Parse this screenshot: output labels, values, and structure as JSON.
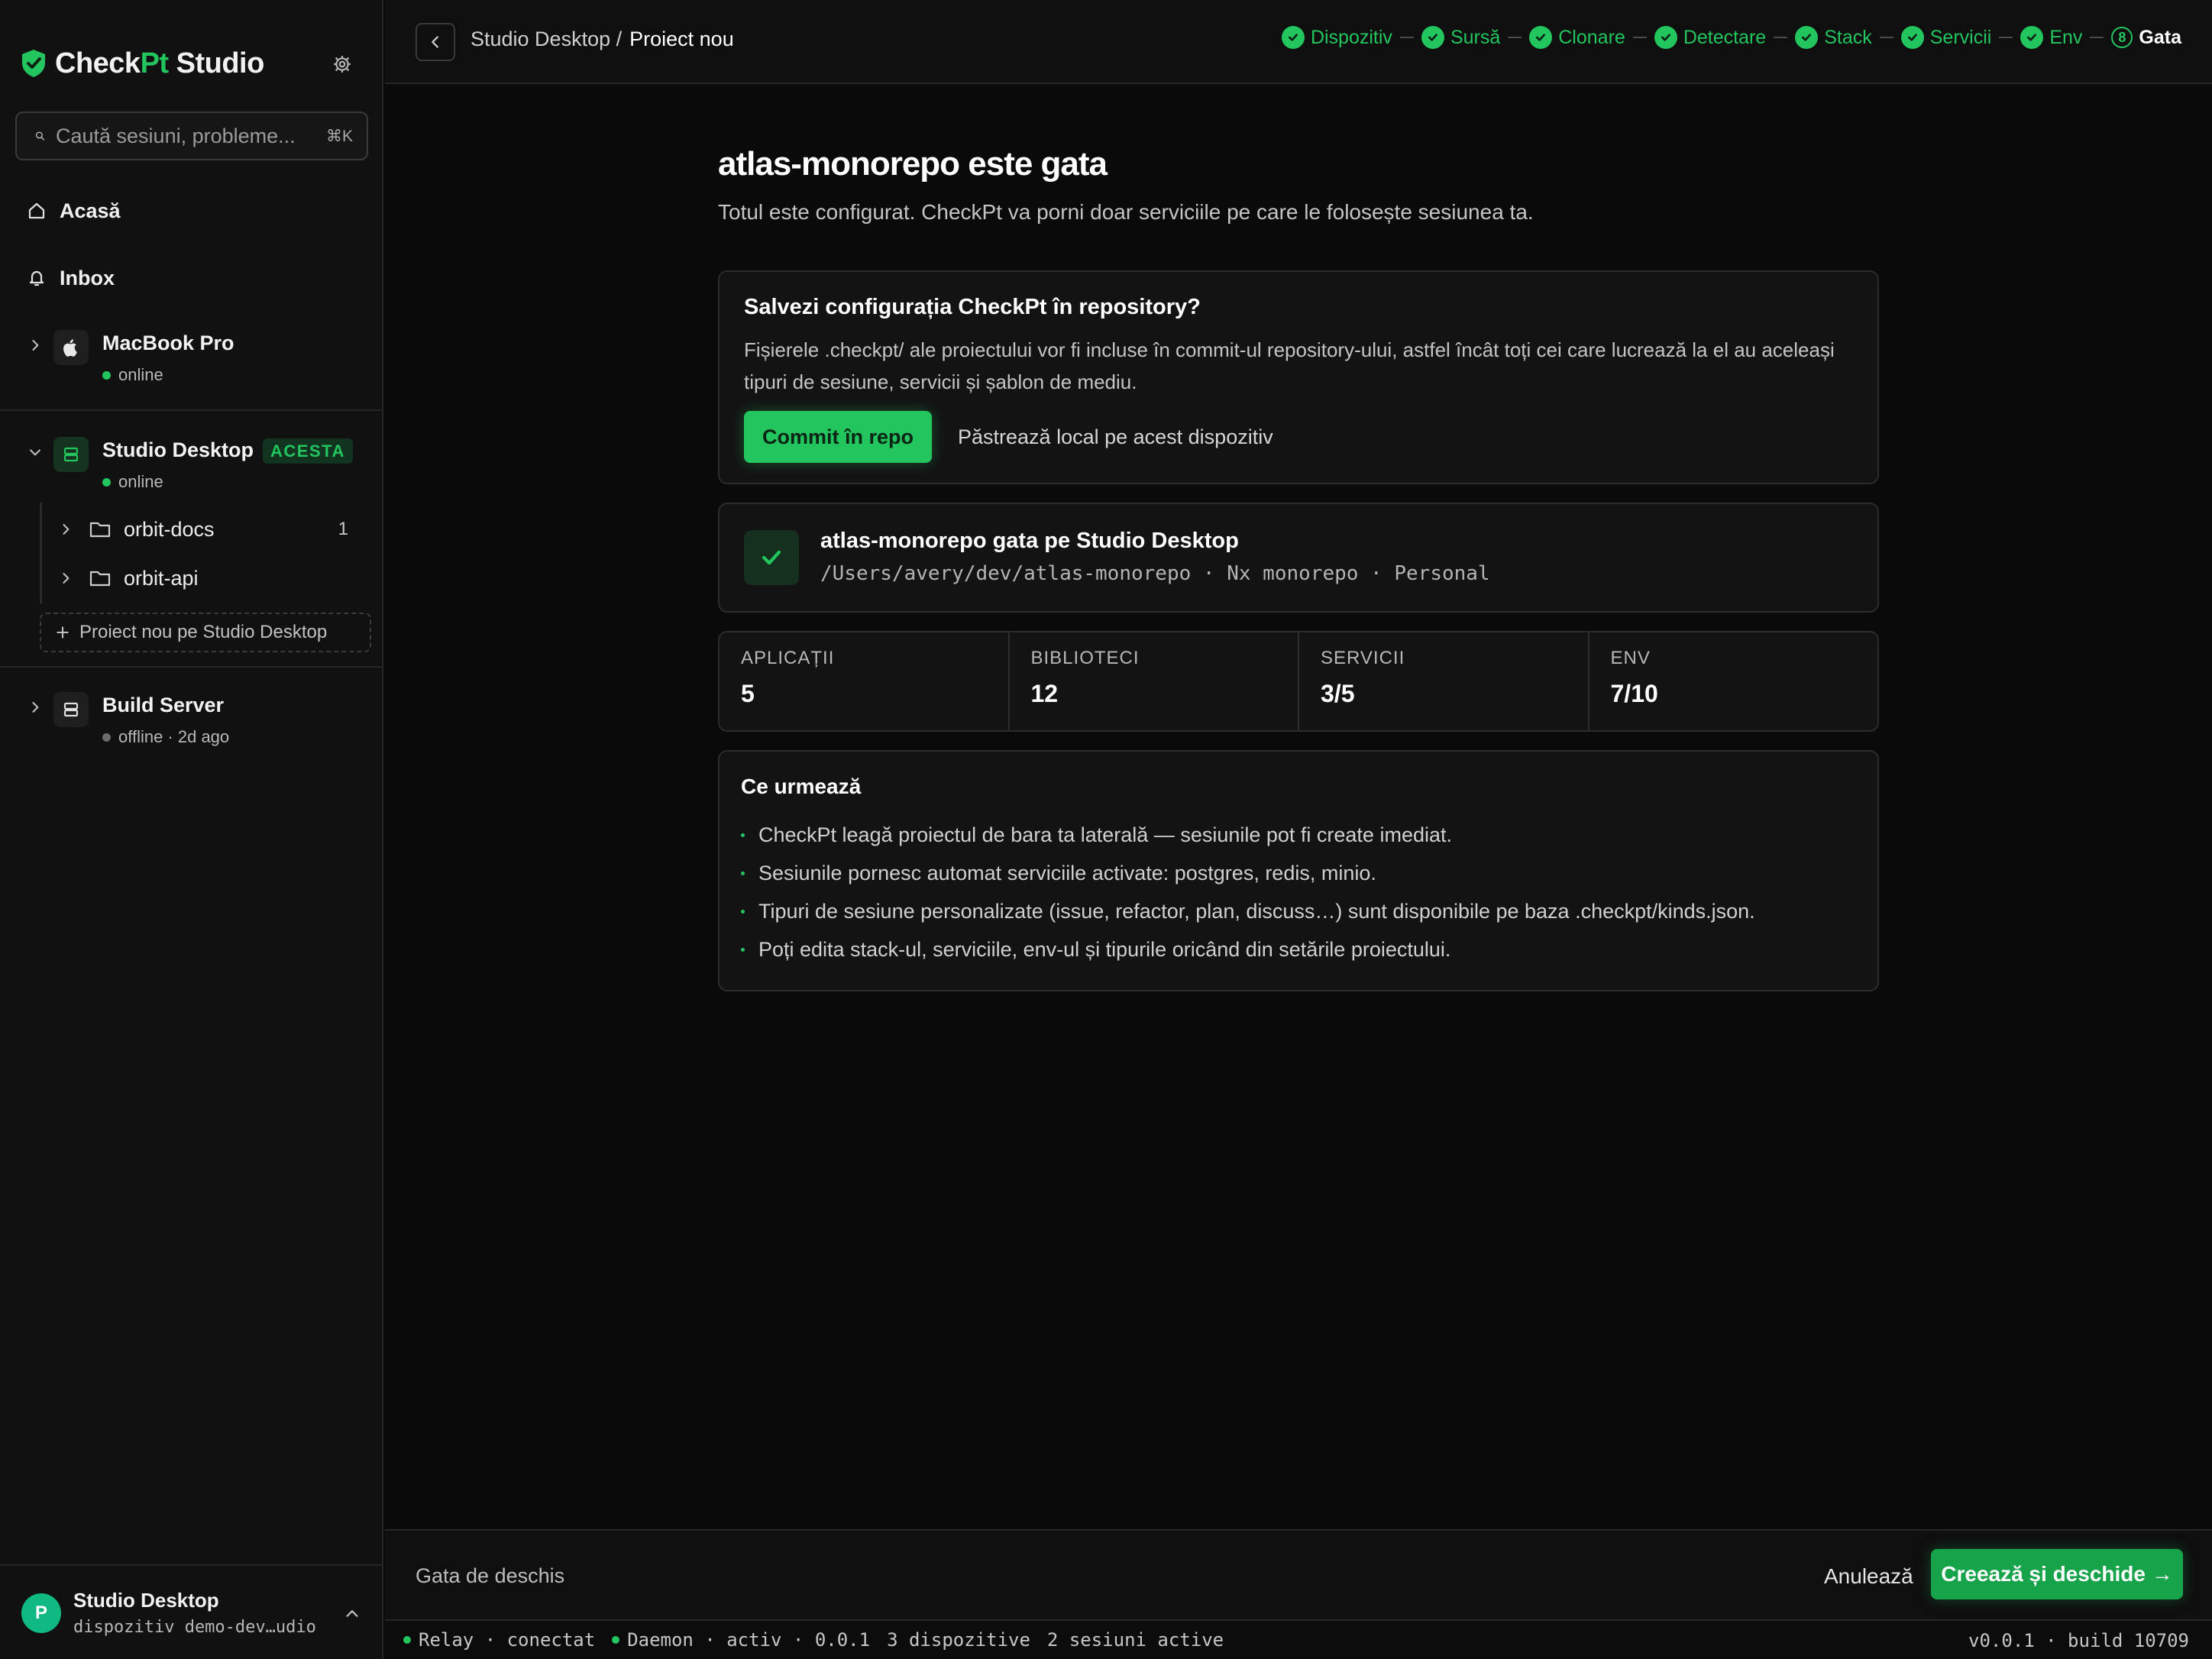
{
  "brand": {
    "name_start": "Check",
    "name_accent": "Pt",
    "name_end": " Studio"
  },
  "search": {
    "placeholder": "Caută sesiuni, probleme...",
    "shortcut": "⌘K"
  },
  "nav": {
    "home": "Acasă",
    "inbox": "Inbox"
  },
  "devices": {
    "macbook": {
      "name": "MacBook Pro",
      "status": "online"
    },
    "studio": {
      "name": "Studio Desktop",
      "badge": "ACESTA",
      "status": "online",
      "projects": [
        {
          "name": "orbit-docs",
          "count": "1"
        },
        {
          "name": "orbit-api",
          "count": ""
        }
      ],
      "new_project": "Proiect nou pe Studio Desktop"
    },
    "build": {
      "name": "Build Server",
      "status": "offline · 2d ago"
    }
  },
  "user": {
    "avatar": "P",
    "name": "Studio Desktop",
    "sub": "dispozitiv demo-dev…udio"
  },
  "topbar": {
    "breadcrumb_parent": "Studio Desktop /",
    "breadcrumb_current": "Proiect nou",
    "steps": [
      "Dispozitiv",
      "Sursă",
      "Clonare",
      "Detectare",
      "Stack",
      "Servicii",
      "Env"
    ],
    "current_step_number": "8",
    "current_step_label": "Gata"
  },
  "main": {
    "title": "atlas-monorepo este gata",
    "subtitle": "Totul este configurat. CheckPt va porni doar serviciile pe care le folosește sesiunea ta.",
    "save": {
      "title": "Salvezi configurația CheckPt în repository?",
      "description": "Fișierele .checkpt/ ale proiectului vor fi incluse în commit-ul repository-ului, astfel încât toți cei care lucrează la el au aceleași tipuri de sesiune, servicii și șablon de mediu.",
      "commit_label": "Commit în repo",
      "keep_local_label": "Păstrează local pe acest dispozitiv"
    },
    "ready": {
      "title": "atlas-monorepo gata pe Studio Desktop",
      "path": "/Users/avery/dev/atlas-monorepo · Nx monorepo · Personal"
    },
    "stats": [
      {
        "label": "APLICAȚII",
        "value": "5"
      },
      {
        "label": "BIBLIOTECI",
        "value": "12"
      },
      {
        "label": "SERVICII",
        "value": "3/5"
      },
      {
        "label": "ENV",
        "value": "7/10"
      }
    ],
    "next": {
      "title": "Ce urmează",
      "items": [
        "CheckPt leagă proiectul de bara ta laterală — sesiunile pot fi create imediat.",
        "Sesiunile pornesc automat serviciile activate: postgres, redis, minio.",
        "Tipuri de sesiune personalizate (issue, refactor, plan, discuss…) sunt disponibile pe baza .checkpt/kinds.json.",
        "Poți edita stack-ul, serviciile, env-ul și tipurile oricând din setările proiectului."
      ]
    }
  },
  "footer": {
    "ready_text": "Gata de deschis",
    "cancel_label": "Anulează",
    "create_label": "Creează și deschide →"
  },
  "status_bar": {
    "relay": "Relay · conectat",
    "daemon": "Daemon · activ · 0.0.1",
    "devices": "3 dispozitive",
    "sessions": "2 sesiuni active",
    "version": "v0.0.1 · build 10709"
  },
  "colors": {
    "accent": "#22c55e",
    "background": "#0a0a0a",
    "sidebar": "#111111"
  },
  "icons": [
    "shield-check-icon",
    "gear-icon",
    "search-icon",
    "home-icon",
    "bell-icon",
    "apple-icon",
    "server-icon",
    "folder-icon",
    "chevron-right-icon",
    "chevron-down-icon",
    "chevron-left-icon",
    "chevron-up-icon",
    "check-icon",
    "plus-icon"
  ]
}
